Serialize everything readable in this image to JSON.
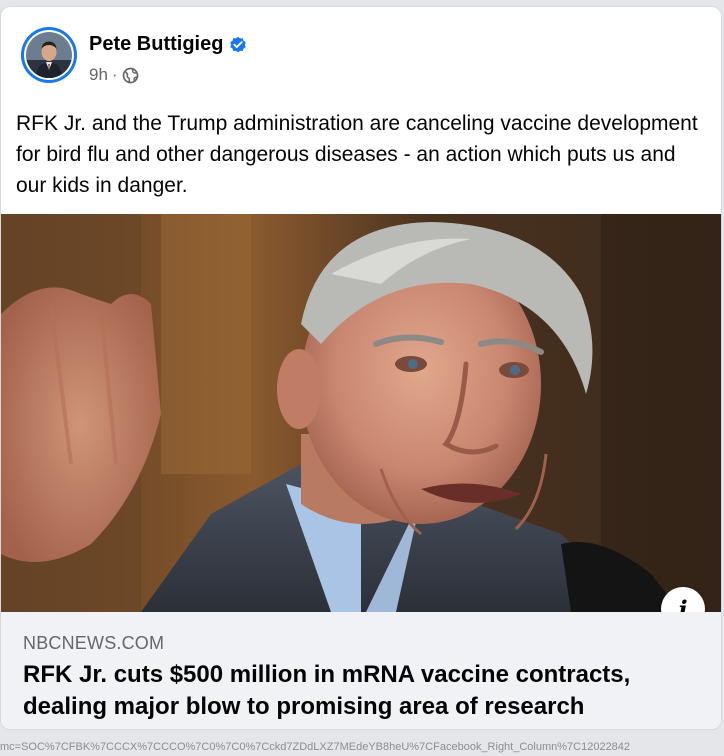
{
  "post": {
    "author": {
      "name": "Pete Buttigieg",
      "verified_icon": "verified-badge-icon",
      "avatar_icon": "profile-photo"
    },
    "timestamp": "9h",
    "separator": "·",
    "audience_icon": "globe-icon",
    "text": "RFK Jr. and the Trump administration are canceling vaccine development for bird flu and other dangerous diseases - an action which puts us and our kids in danger.",
    "image": {
      "description_icon": "news-photo"
    },
    "info_button": {
      "label": "i"
    },
    "link": {
      "domain": "NBCNEWS.COM",
      "title": "RFK Jr. cuts $500 million in mRNA vaccine contracts, dealing major blow to promising area of research"
    }
  },
  "url_fragment": "mc=SOC%7CFBK%7CCCX%7CCCO%7C0%7C0%7Cckd7ZDdLXZ7MEdeYB8heU%7CFacebook_Right_Column%7C12022842",
  "colors": {
    "verified_blue": "#1877f2",
    "secondary_text": "#65676b",
    "preview_bg": "#f0f2f5"
  }
}
